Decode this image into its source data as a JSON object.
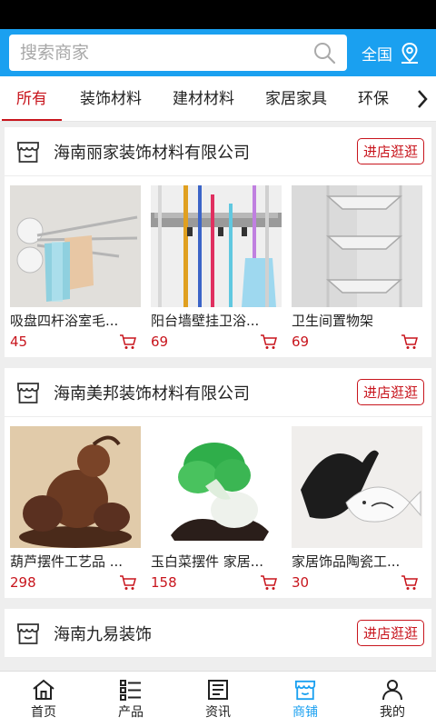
{
  "search": {
    "placeholder": "搜索商家"
  },
  "region": {
    "label": "全国"
  },
  "tabs": [
    {
      "label": "所有",
      "active": true
    },
    {
      "label": "装饰材料"
    },
    {
      "label": "建材材料"
    },
    {
      "label": "家居家具"
    },
    {
      "label": "环保"
    }
  ],
  "visit_label": "进店逛逛",
  "shops": [
    {
      "name": "海南丽家装饰材料有限公司",
      "products": [
        {
          "name": "吸盘四杆浴室毛...",
          "price": "45",
          "image": "towel-rack"
        },
        {
          "name": "阳台墙壁挂卫浴...",
          "price": "69",
          "image": "mop-holder"
        },
        {
          "name": "卫生间置物架",
          "price": "69",
          "image": "corner-shelf"
        }
      ]
    },
    {
      "name": "海南美邦装饰材料有限公司",
      "products": [
        {
          "name": "葫芦摆件工艺品 ...",
          "price": "298",
          "image": "gourd-ornament"
        },
        {
          "name": "玉白菜摆件 家居...",
          "price": "158",
          "image": "jade-cabbage"
        },
        {
          "name": "家居饰品陶瓷工...",
          "price": "30",
          "image": "ceramic-fish"
        }
      ]
    },
    {
      "name": "海南九易装饰",
      "products": []
    }
  ],
  "bottom_nav": [
    {
      "label": "首页",
      "icon": "home-icon"
    },
    {
      "label": "产品",
      "icon": "list-icon"
    },
    {
      "label": "资讯",
      "icon": "news-icon"
    },
    {
      "label": "商铺",
      "icon": "shop-icon",
      "active": true
    },
    {
      "label": "我的",
      "icon": "user-icon"
    }
  ],
  "colors": {
    "brand_blue": "#1aa0f0",
    "accent_red": "#c8151d"
  }
}
